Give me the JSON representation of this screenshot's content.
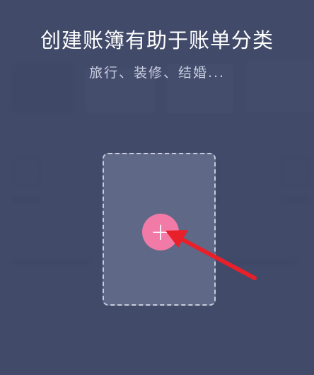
{
  "guide": {
    "title": "创建账簿有助于账单分类",
    "subtitle": "旅行、装修、结婚...",
    "add_button_label": "+"
  },
  "colors": {
    "background": "#434c6b",
    "card": "#5f6886",
    "add_button": "#f27aa6",
    "arrow": "#e8202a"
  },
  "icons": {
    "add": "plus-icon",
    "arrow": "pointer-arrow-icon"
  }
}
